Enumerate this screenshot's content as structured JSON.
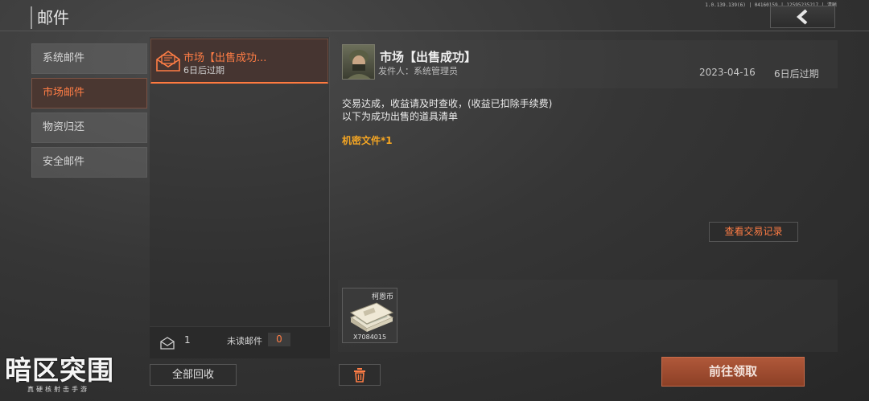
{
  "header": {
    "title": "邮件",
    "version": "1.0.139.139(6) | 04160159 | 12595235217 | 清晰"
  },
  "sidebar": {
    "items": [
      {
        "label": "系统邮件",
        "active": false
      },
      {
        "label": "市场邮件",
        "active": true
      },
      {
        "label": "物资归还",
        "active": false
      },
      {
        "label": "安全邮件",
        "active": false
      }
    ]
  },
  "mail_list": {
    "items": [
      {
        "subject": "市场【出售成功...",
        "expiry": "6日后过期",
        "selected": true
      }
    ],
    "total_count": "1",
    "unread_label": "未读邮件",
    "unread_count": "0",
    "collect_all_label": "全部回收"
  },
  "detail": {
    "title": "市场【出售成功】",
    "sender": "发件人：系统管理员",
    "date": "2023-04-16",
    "expiry": "6日后过期",
    "body_lines": [
      "交易达成，收益请及时查收，(收益已扣除手续费)",
      "以下为成功出售的道具清单"
    ],
    "item_line": "机密文件*1",
    "history_button_label": "查看交易记录",
    "attachments": [
      {
        "name": "柯恩币",
        "quantity": "X7084015",
        "icon": "cash-stack-icon"
      }
    ],
    "claim_button_label": "前往领取"
  },
  "logo": {
    "title": "暗区突围",
    "subtitle": "真硬核射击手游"
  },
  "colors": {
    "accent": "#ff7d45",
    "item_highlight": "#f5a623",
    "claim_button": "#a04c2f"
  }
}
